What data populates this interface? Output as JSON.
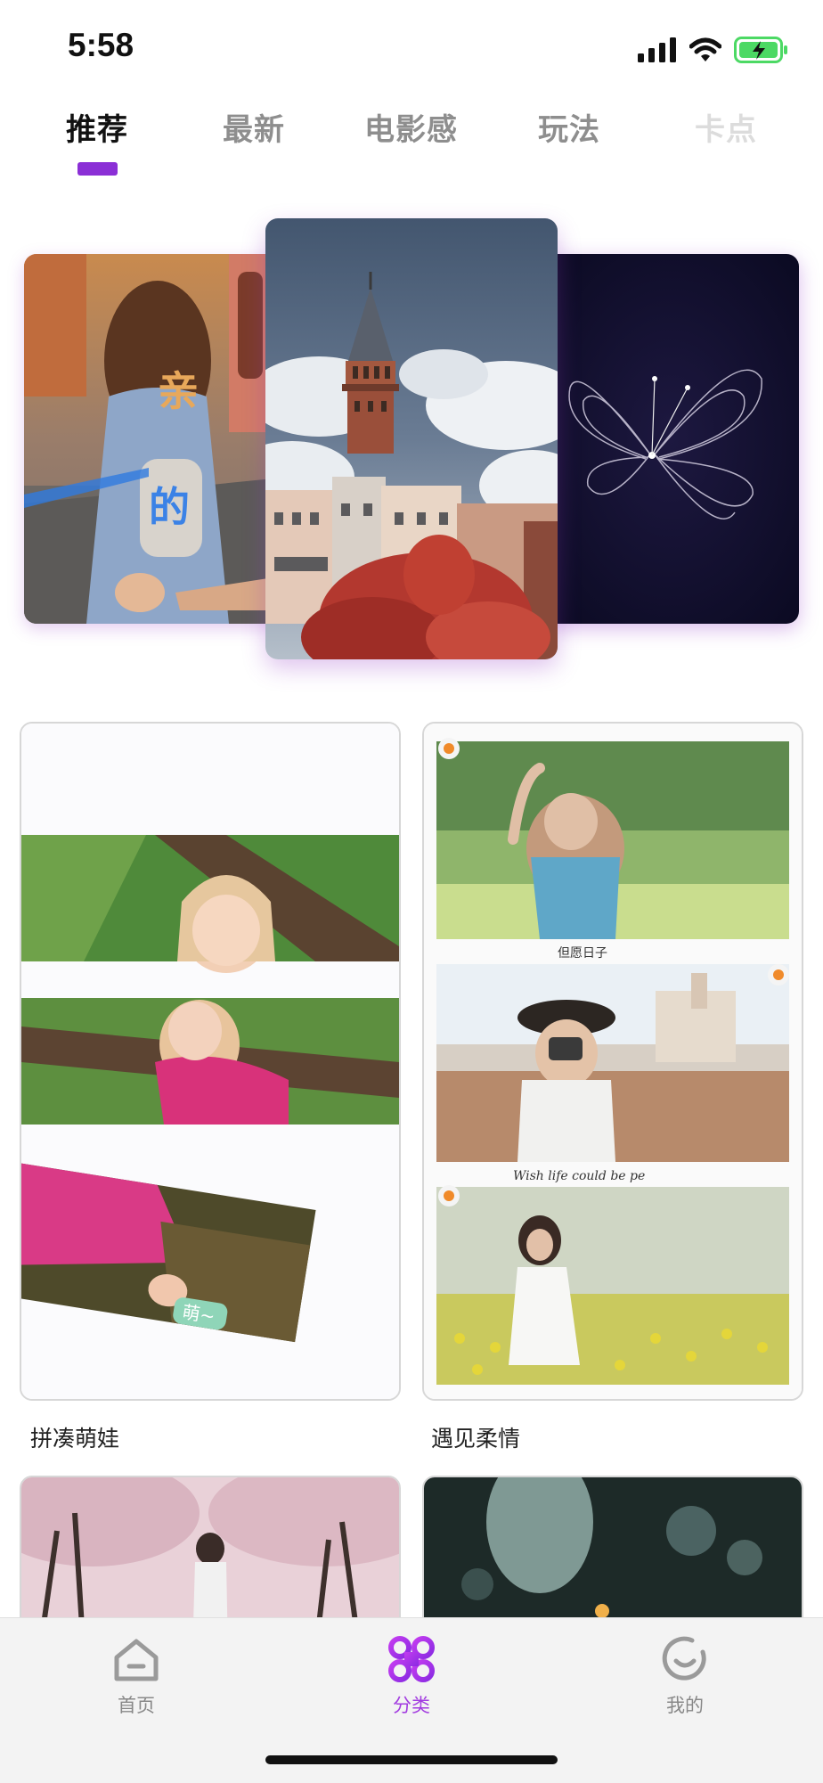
{
  "status_bar": {
    "time": "5:58"
  },
  "tabs": [
    {
      "label": "推荐",
      "active": true
    },
    {
      "label": "最新",
      "active": false
    },
    {
      "label": "电影感",
      "active": false
    },
    {
      "label": "玩法",
      "active": false
    },
    {
      "label": "卡点",
      "active": false
    }
  ],
  "carousel": {
    "left_card_text_1": "亲",
    "left_card_text_2": "的"
  },
  "templates": [
    {
      "title": "拼凑萌娃",
      "sticker": "萌~"
    },
    {
      "title": "遇见柔情",
      "caption_1": "但愿日子",
      "caption_2": "Wish life could be pe"
    }
  ],
  "bottom_nav": [
    {
      "label": "首页",
      "icon": "home-icon",
      "active": false
    },
    {
      "label": "分类",
      "icon": "category-icon",
      "active": true
    },
    {
      "label": "我的",
      "icon": "profile-icon",
      "active": false
    }
  ],
  "colors": {
    "accent": "#8b2fd6",
    "active_nav": "#a23be0",
    "battery": "#4cd964"
  }
}
